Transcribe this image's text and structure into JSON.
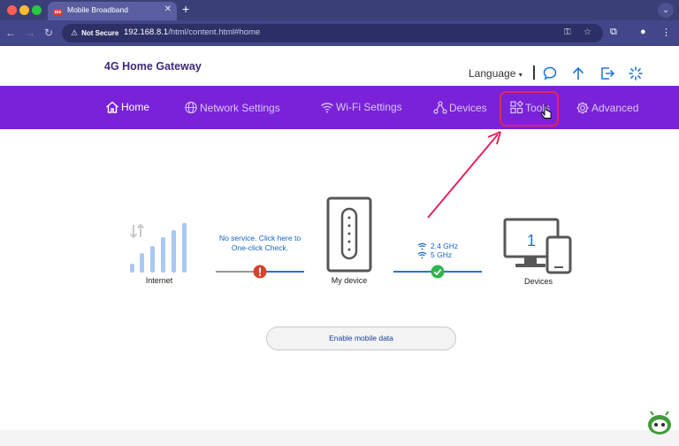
{
  "browser": {
    "tab_title": "Mobile Broadband",
    "tab_close": "✕",
    "new_tab": "+",
    "security_label": "Not Secure",
    "url_host": "192.168.8.1",
    "url_path": "/html/content.html#home"
  },
  "header": {
    "brand": "4G Home Gateway",
    "language_label": "Language"
  },
  "nav": {
    "home": "Home",
    "network_settings": "Network Settings",
    "wifi_settings": "Wi-Fi Settings",
    "devices": "Devices",
    "tools": "Tools",
    "advanced": "Advanced"
  },
  "status": {
    "internet_label": "Internet",
    "no_service_message": "No service. Click here to One-click Check.",
    "my_device_label": "My device",
    "wifi_24": "2.4 GHz",
    "wifi_5": "5 GHz",
    "device_count": "1",
    "devices_label": "Devices",
    "enable_mobile_data": "Enable mobile data"
  },
  "colors": {
    "navbar": "#7a22d8",
    "highlight": "#e0245e",
    "link_blue": "#1565c0",
    "error_red": "#d9412a",
    "ok_green": "#2fb44a"
  }
}
